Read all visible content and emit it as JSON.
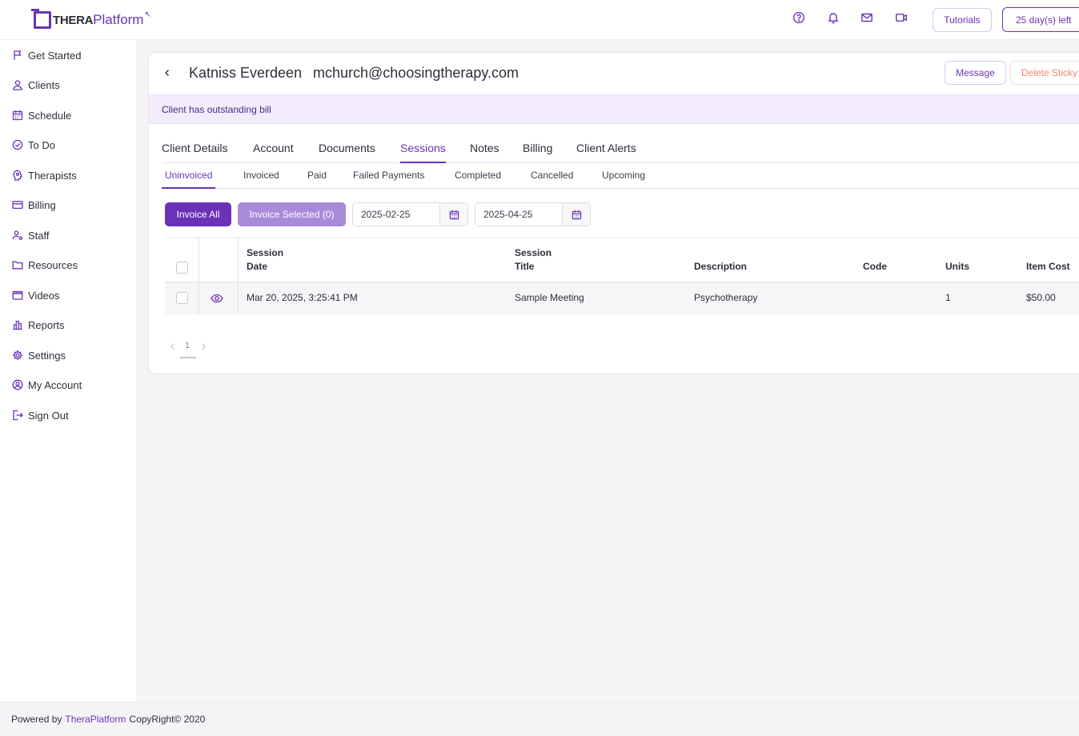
{
  "brand": {
    "logo_bold": "THERA",
    "logo_light": "Platform",
    "accent": "#6b32b8"
  },
  "topbar": {
    "icons": [
      "help-icon",
      "bell-icon",
      "mail-icon",
      "video-icon"
    ],
    "tutorials_label": "Tutorials",
    "trial_label": "25 day(s) left"
  },
  "sidebar": {
    "items": [
      {
        "label": "Get Started",
        "icon": "flag-icon"
      },
      {
        "label": "Clients",
        "icon": "user-icon"
      },
      {
        "label": "Schedule",
        "icon": "calendar-icon"
      },
      {
        "label": "To Do",
        "icon": "check-circle-icon"
      },
      {
        "label": "Therapists",
        "icon": "therapist-icon"
      },
      {
        "label": "Billing",
        "icon": "credit-card-icon"
      },
      {
        "label": "Staff",
        "icon": "staff-icon"
      },
      {
        "label": "Resources",
        "icon": "folder-icon"
      },
      {
        "label": "Videos",
        "icon": "film-icon"
      },
      {
        "label": "Reports",
        "icon": "bar-chart-icon"
      },
      {
        "label": "Settings",
        "icon": "gear-icon"
      },
      {
        "label": "My Account",
        "icon": "account-circle-icon"
      },
      {
        "label": "Sign Out",
        "icon": "sign-out-icon"
      }
    ]
  },
  "client": {
    "name": "Katniss Everdeen",
    "email": "mchurch@choosingtherapy.com",
    "message_label": "Message",
    "delete_label": "Delete Sticky Alert",
    "alert_text": "Client has outstanding bill"
  },
  "tabs": [
    "Client Details",
    "Account",
    "Documents",
    "Sessions",
    "Notes",
    "Billing",
    "Client Alerts"
  ],
  "active_tab": "Sessions",
  "subtabs": [
    "Uninvoiced",
    "Invoiced",
    "Paid",
    "Failed Payments",
    "Completed",
    "Cancelled",
    "Upcoming"
  ],
  "active_subtab": "Uninvoiced",
  "actions": {
    "invoice_all": "Invoice All",
    "invoice_selected": "Invoice Selected (0)",
    "date_from": "2025-02-25",
    "date_to": "2025-04-25"
  },
  "table": {
    "headers": {
      "session_date_1": "Session",
      "session_date_2": "Date",
      "session_title_1": "Session",
      "session_title_2": "Title",
      "description": "Description",
      "code": "Code",
      "units": "Units",
      "item_cost": "Item Cost"
    },
    "rows": [
      {
        "date": "Mar 20, 2025, 3:25:41 PM",
        "title": "Sample Meeting",
        "description": "Psychotherapy",
        "code": "",
        "units": "1",
        "item_cost": "$50.00"
      }
    ]
  },
  "pagination": {
    "current_page": "1"
  },
  "footer": {
    "prefix": "Powered by",
    "brand": "TheraPlatform",
    "suffix": "CopyRight© 2020"
  }
}
